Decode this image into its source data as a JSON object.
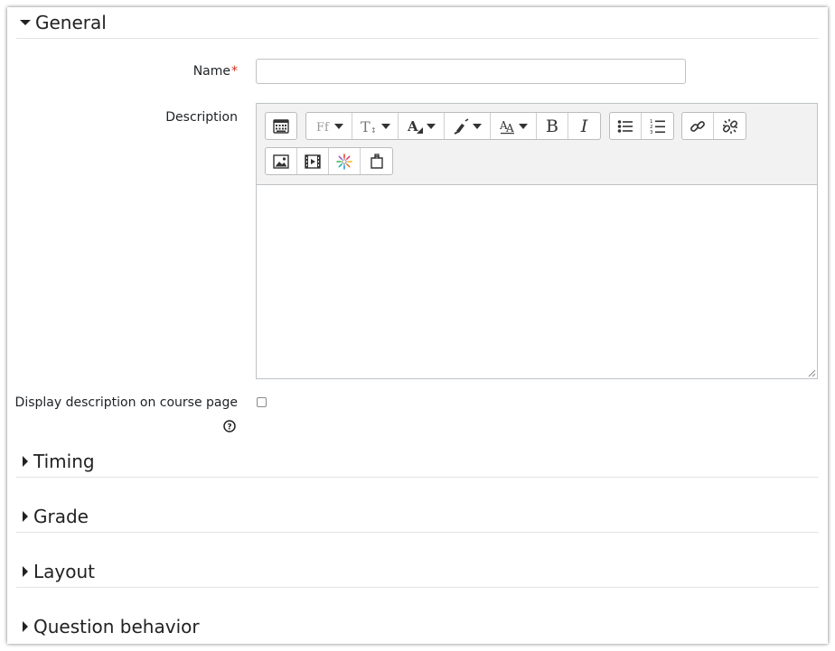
{
  "sections": {
    "general": "General",
    "timing": "Timing",
    "grade": "Grade",
    "layout": "Layout",
    "question_behavior": "Question behavior"
  },
  "form": {
    "name_label": "Name",
    "required_mark": "*",
    "name_value": "",
    "description_label": "Description",
    "display_description_label": "Display description on course page",
    "display_description_checked": false
  },
  "toolbar": {
    "row1": [
      "show-more-buttons-icon",
      "font-family-icon",
      "font-size-icon",
      "font-color-icon",
      "background-color-icon",
      "font-format-icon",
      "bold-icon",
      "italic-icon",
      "unordered-list-icon",
      "ordered-list-icon",
      "link-icon",
      "unlink-icon"
    ],
    "row2": [
      "image-icon",
      "media-icon",
      "recordrtc-icon",
      "manage-files-icon"
    ],
    "bold_glyph": "B",
    "italic_glyph": "I"
  },
  "colors": {
    "required": "#ca3120",
    "toolbar_bg": "#f2f2f2",
    "border": "#bfc2c5"
  }
}
